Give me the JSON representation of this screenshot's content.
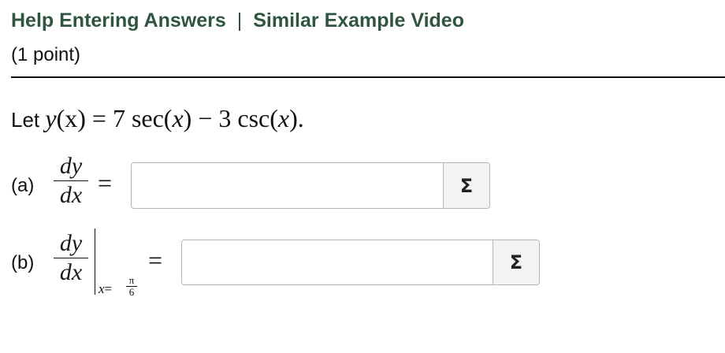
{
  "header": {
    "help_link": "Help Entering Answers",
    "separator": "|",
    "video_link": "Similar Example Video"
  },
  "points": "(1 point)",
  "problem": {
    "prefix": "Let ",
    "y": "y",
    "x": "(x)",
    "rest": " = 7 sec(",
    "x2": "x",
    "rest2": ") − 3 csc(",
    "x3": "x",
    "rest3": ")."
  },
  "part_a": {
    "label": "(a)",
    "num": "dy",
    "den": "dx",
    "equals": "=",
    "input_value": "",
    "sigma": "Σ"
  },
  "part_b": {
    "label": "(b)",
    "num": "dy",
    "den": "dx",
    "sub_var": "x",
    "sub_eq": "=",
    "sub_num": "π",
    "sub_den": "6",
    "equals": "=",
    "input_value": "",
    "sigma": "Σ"
  }
}
